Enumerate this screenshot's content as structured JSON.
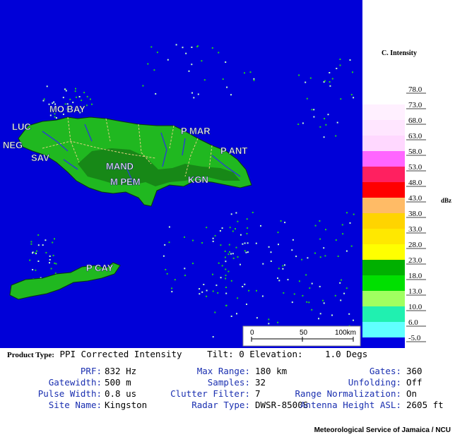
{
  "map": {
    "places": [
      {
        "id": "mobay",
        "label": "MO BAY"
      },
      {
        "id": "luc",
        "label": "LUC"
      },
      {
        "id": "neg",
        "label": "NEG"
      },
      {
        "id": "sav",
        "label": "SAV"
      },
      {
        "id": "pmar",
        "label": "P MAR"
      },
      {
        "id": "pant",
        "label": "P ANT"
      },
      {
        "id": "mand",
        "label": "MAND"
      },
      {
        "id": "mpem",
        "label": "M PEM"
      },
      {
        "id": "kgn",
        "label": "KGN"
      },
      {
        "id": "pcay",
        "label": "P CAY"
      }
    ],
    "scale": {
      "ticks": [
        "0",
        "50",
        "100km"
      ]
    },
    "colors": {
      "sea": "#0000d8",
      "land": "#20b820",
      "echo": "#c8ffc8"
    }
  },
  "legend": {
    "title": "C. Intensity",
    "unit": "dBz",
    "levels": [
      {
        "label": "78.0",
        "color": "#ffffff"
      },
      {
        "label": "73.0",
        "color": "#fff0ff"
      },
      {
        "label": "68.0",
        "color": "#ffe6ff"
      },
      {
        "label": "63.0",
        "color": "#ffd8ff"
      },
      {
        "label": "58.0",
        "color": "#ff66ff"
      },
      {
        "label": "53.0",
        "color": "#ff2060"
      },
      {
        "label": "48.0",
        "color": "#ff0000"
      },
      {
        "label": "43.0",
        "color": "#ffbb66"
      },
      {
        "label": "38.0",
        "color": "#ffd400"
      },
      {
        "label": "33.0",
        "color": "#ffe800"
      },
      {
        "label": "28.0",
        "color": "#ffff00"
      },
      {
        "label": "23.0",
        "color": "#00b000"
      },
      {
        "label": "18.0",
        "color": "#00e000"
      },
      {
        "label": "13.0",
        "color": "#a0ff60"
      },
      {
        "label": "10.0",
        "color": "#20f0b0"
      },
      {
        "label": "6.0",
        "color": "#60ffff"
      },
      {
        "label": "-5.0",
        "color": "#0000e0"
      }
    ]
  },
  "product": {
    "type_label": "Product Type:",
    "type_value": "PPI Corrected Intensity",
    "tilt": "Tilt: 0 Elevation:",
    "elevation": "1.0 Degs"
  },
  "params": {
    "prf_k": "PRF:",
    "prf_v": "832 Hz",
    "maxrange_k": "Max Range:",
    "maxrange_v": "180 km",
    "gates_k": "Gates:",
    "gates_v": "360",
    "gatewidth_k": "Gatewidth:",
    "gatewidth_v": "500 m",
    "samples_k": "Samples:",
    "samples_v": "32",
    "unfolding_k": "Unfolding:",
    "unfolding_v": "Off",
    "pulse_k": "Pulse Width:",
    "pulse_v": "0.8 us",
    "clutter_k": "Clutter Filter:",
    "clutter_v": "7",
    "rangenorm_k": "Range Normalization:",
    "rangenorm_v": "On",
    "site_k": "Site Name:",
    "site_v": "Kingston",
    "radar_k": "Radar Type:",
    "radar_v": "DWSR-8500S",
    "antenna_k": "Antenna Height ASL:",
    "antenna_v": "2605 ft"
  },
  "credit": "Meteorological Service of Jamaica / NCU"
}
